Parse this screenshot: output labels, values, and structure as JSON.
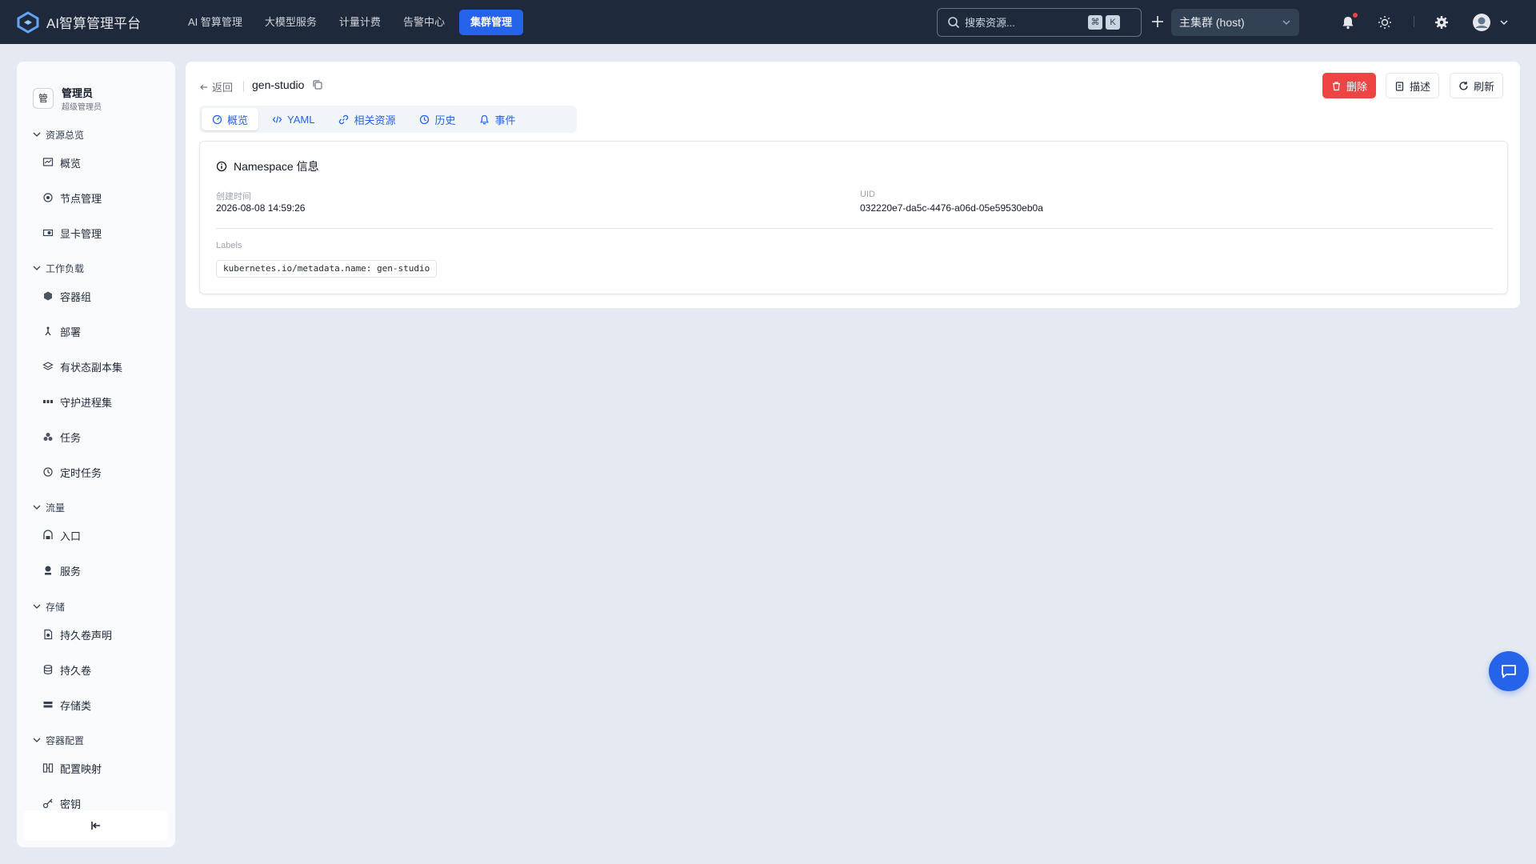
{
  "app": {
    "title": "AI智算管理平台",
    "nav": [
      "AI 智算管理",
      "大模型服务",
      "计量计费",
      "告警中心",
      "集群管理"
    ],
    "active_nav_index": 4
  },
  "search": {
    "placeholder": "搜索资源...",
    "shortcut_keys": [
      "⌘",
      "K"
    ]
  },
  "cluster": {
    "selected": "主集群 (host)"
  },
  "user": {
    "name": "管理员",
    "role": "超级管理员",
    "avatar_text": "管"
  },
  "sidebar": {
    "sections": [
      {
        "title": "资源总览",
        "items": [
          {
            "label": "概览",
            "icon": "dashboard-icon"
          },
          {
            "label": "节点管理",
            "icon": "node-icon"
          },
          {
            "label": "显卡管理",
            "icon": "gpu-icon"
          }
        ]
      },
      {
        "title": "工作负载",
        "items": [
          {
            "label": "容器组",
            "icon": "pod-icon"
          },
          {
            "label": "部署",
            "icon": "deployment-icon"
          },
          {
            "label": "有状态副本集",
            "icon": "layers-icon"
          },
          {
            "label": "守护进程集",
            "icon": "daemonset-icon"
          },
          {
            "label": "任务",
            "icon": "job-icon"
          },
          {
            "label": "定时任务",
            "icon": "clock-icon"
          }
        ]
      },
      {
        "title": "流量",
        "items": [
          {
            "label": "入口",
            "icon": "ingress-icon"
          },
          {
            "label": "服务",
            "icon": "service-icon"
          }
        ]
      },
      {
        "title": "存储",
        "items": [
          {
            "label": "持久卷声明",
            "icon": "file-icon"
          },
          {
            "label": "持久卷",
            "icon": "database-icon"
          },
          {
            "label": "存储类",
            "icon": "storage-class-icon"
          }
        ]
      },
      {
        "title": "容器配置",
        "items": [
          {
            "label": "配置映射",
            "icon": "configmap-icon"
          },
          {
            "label": "密钥",
            "icon": "key-icon"
          }
        ]
      }
    ]
  },
  "page": {
    "back_label": "返回",
    "namespace_name": "gen-studio",
    "actions": {
      "delete": "删除",
      "describe": "描述",
      "refresh": "刷新"
    },
    "tabs": [
      "概览",
      "YAML",
      "相关资源",
      "历史",
      "事件"
    ],
    "active_tab_index": 0,
    "card": {
      "title": "Namespace 信息",
      "created_label": "创建时间",
      "created_value": "2026-08-08 14:59:26",
      "uid_label": "UID",
      "uid_value": "032220e7-da5c-4476-a06d-05e59530eb0a",
      "labels_label": "Labels",
      "labels": [
        "kubernetes.io/metadata.name: gen-studio"
      ]
    }
  },
  "colors": {
    "topbar": "#1e293b",
    "accent": "#2563eb",
    "danger": "#ef4444",
    "background": "#e5eaf2"
  }
}
